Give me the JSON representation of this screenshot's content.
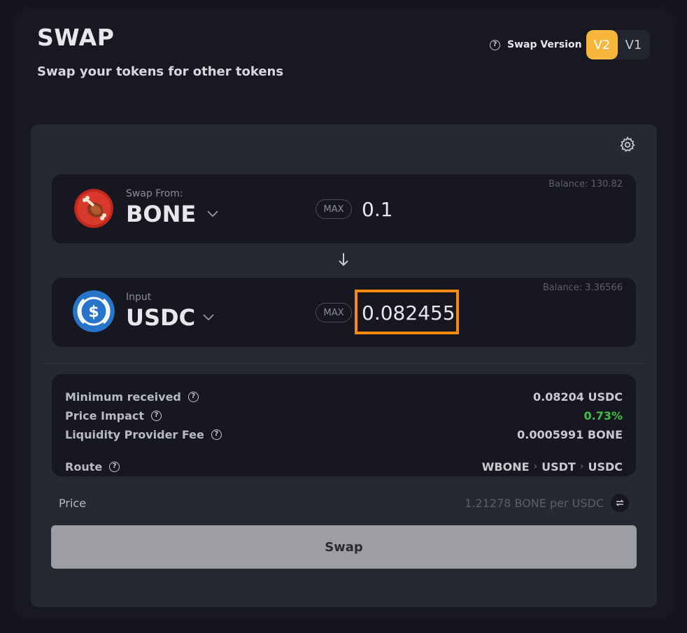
{
  "header": {
    "title": "SWAP",
    "subtitle": "Swap your tokens for other tokens",
    "version_label": "Swap Version",
    "versions": [
      "V2",
      "V1"
    ],
    "active_version": "V2"
  },
  "from": {
    "caption": "Swap From:",
    "symbol": "BONE",
    "max_label": "MAX",
    "amount": "0.1",
    "balance": "Balance: 130.82",
    "icon": "bone-token-icon"
  },
  "to": {
    "caption": "Input",
    "symbol": "USDC",
    "max_label": "MAX",
    "amount": "0.082455",
    "balance": "Balance: 3.36566",
    "icon": "usdc-token-icon"
  },
  "details": {
    "minimum_received": {
      "label": "Minimum received",
      "value": "0.08204 USDC"
    },
    "price_impact": {
      "label": "Price Impact",
      "value": "0.73%"
    },
    "lp_fee": {
      "label": "Liquidity Provider Fee",
      "value": "0.0005991 BONE"
    },
    "route": {
      "label": "Route",
      "hops": [
        "WBONE",
        "USDT",
        "USDC"
      ]
    }
  },
  "price": {
    "label": "Price",
    "value": "1.21278 BONE per USDC"
  },
  "swap_button_label": "Swap",
  "colors": {
    "accent": "#f6b73c",
    "highlight": "#f98a0f",
    "positive": "#3fbf4a",
    "usdc_blue": "#2775ca",
    "bone_red": "#c0281e"
  }
}
